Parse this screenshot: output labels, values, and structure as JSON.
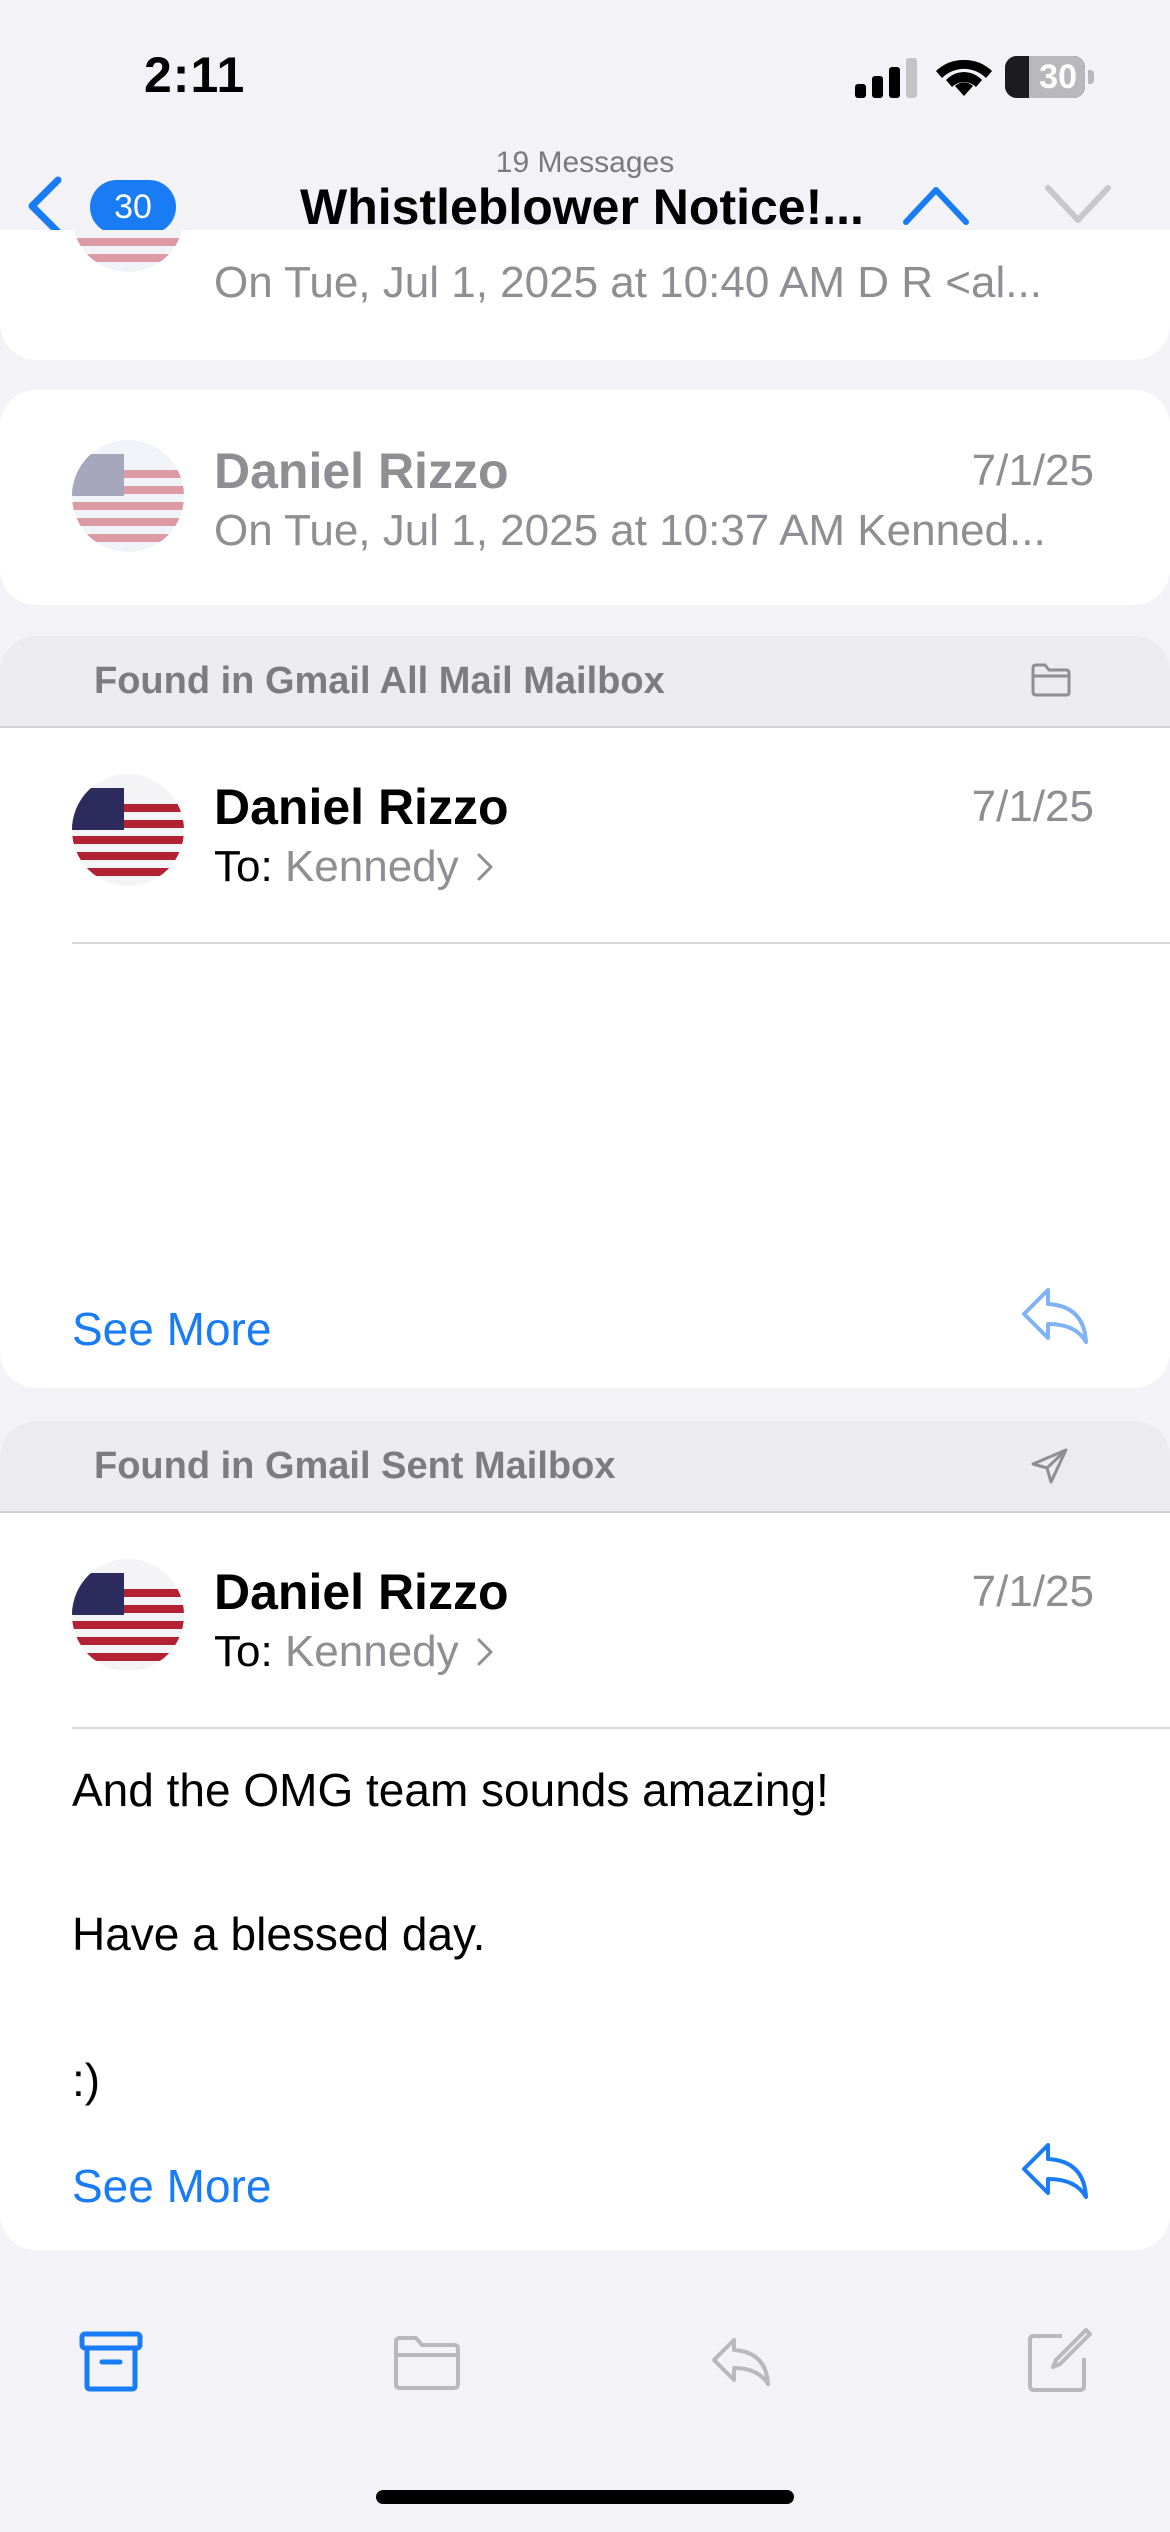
{
  "status_bar": {
    "time": "2:11",
    "battery": "30"
  },
  "nav": {
    "back_badge": "30",
    "message_count": "19 Messages",
    "title": "Whistleblower Notice!..."
  },
  "card_top_partial": {
    "preview": "On Tue, Jul 1, 2025 at 10:40 AM D R <al..."
  },
  "card_two": {
    "sender": "Daniel Rizzo",
    "date": "7/1/25",
    "preview": "On Tue, Jul 1, 2025 at 10:37 AM Kenned..."
  },
  "section_all_mail": {
    "label": "Found in Gmail All Mail Mailbox",
    "icon": "folder-icon",
    "sender": "Daniel Rizzo",
    "date": "7/1/25",
    "to_label": "To:",
    "recipient": "Kennedy",
    "see_more": "See More"
  },
  "section_sent": {
    "label": "Found in Gmail Sent Mailbox",
    "icon": "paper-plane-icon",
    "sender": "Daniel Rizzo",
    "date": "7/1/25",
    "to_label": "To:",
    "recipient": "Kennedy",
    "body": [
      "And the OMG team sounds amazing!",
      "Have a blessed day.",
      ":)"
    ],
    "see_more": "See More"
  },
  "toolbar": {
    "items": [
      "archive-icon",
      "folder-icon",
      "reply-icon",
      "compose-icon"
    ]
  },
  "colors": {
    "accent": "#1a7cf5",
    "muted": "#8e8e93",
    "background": "#f2f2f7"
  }
}
